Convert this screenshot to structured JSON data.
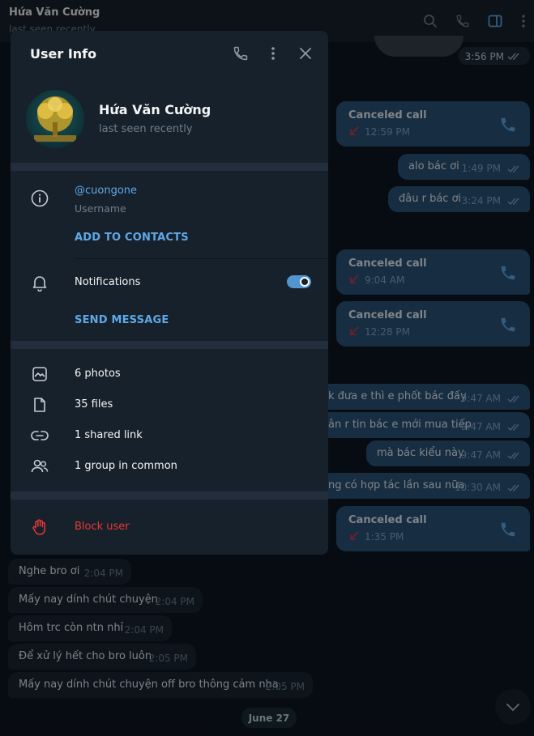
{
  "chat_header": {
    "name": "Hứa Văn Cường",
    "status": "last seen recently"
  },
  "user_info": {
    "title": "User Info",
    "name": "Hứa Văn Cường",
    "status": "last seen recently",
    "username": "@cuongone",
    "username_label": "Username",
    "add_contacts": "ADD TO CONTACTS",
    "notifications_label": "Notifications",
    "notifications_on": true,
    "send_message": "SEND MESSAGE",
    "media": {
      "photos": "6 photos",
      "files": "35 files",
      "links": "1 shared link",
      "groups": "1 group in common"
    },
    "block_user": "Block user"
  },
  "messages_out": [
    {
      "time": "3:56 PM"
    },
    {
      "type": "call",
      "title": "Canceled call",
      "time": "12:59 PM"
    },
    {
      "text": "alo bác ơi",
      "time": "1:49 PM"
    },
    {
      "text": "đâu r bác ơi",
      "time": "3:24 PM"
    },
    {
      "type": "call",
      "title": "Canceled call",
      "time": "9:04 AM"
    },
    {
      "type": "call",
      "title": "Canceled call",
      "time": "12:28 PM"
    },
    {
      "text": "k đưa e thì e phốt bác đấy",
      "time": "9:47 AM"
    },
    {
      "text": "ân r tin bác e mới mua tiếp",
      "time": "9:47 AM"
    },
    {
      "text": "mà bác kiểu này",
      "time": "9:47 AM"
    },
    {
      "text": "ng có hợp tác lần sau nữa",
      "time": "10:30 AM"
    },
    {
      "type": "call",
      "title": "Canceled call",
      "time": "1:35 PM"
    }
  ],
  "messages_in": [
    {
      "text": "Nghe bro ơi",
      "time": "2:04 PM"
    },
    {
      "text": "Mấy nay dính chút chuyện",
      "time": "2:04 PM"
    },
    {
      "text": "Hôm trc còn ntn nhỉ",
      "time": "2:04 PM"
    },
    {
      "text": "Để xử lý hết cho bro luôn",
      "time": "2:05 PM"
    },
    {
      "text": "Mấy nay dính chút chuyện off bro thông cảm nha",
      "time": "2:05 PM"
    }
  ],
  "date_separator": "June 27",
  "colors": {
    "background": "#0e1621",
    "panel": "#17212b",
    "outgoing_bubble": "#2b5278",
    "incoming_bubble": "#182533",
    "accent": "#5fa8e8",
    "danger": "#e53935"
  }
}
